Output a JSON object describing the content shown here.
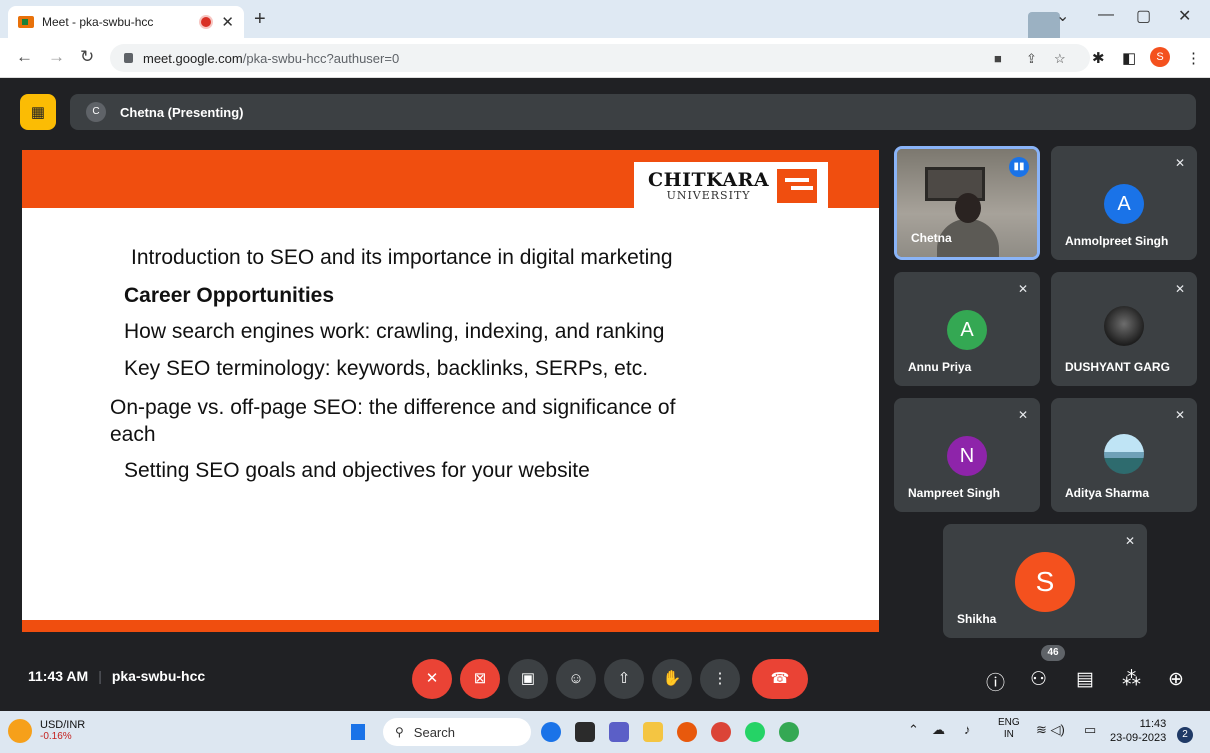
{
  "browser": {
    "tab_title": "Meet - pka-swbu-hcc",
    "url_host": "meet.google.com",
    "url_path": "/pka-swbu-hcc?authuser=0",
    "profile_initial": "S"
  },
  "meet": {
    "presenter_initial": "C",
    "presenter_label": "Chetna (Presenting)",
    "meeting_time": "11:43 AM",
    "meeting_code": "pka-swbu-hcc",
    "participant_count": "46"
  },
  "slide": {
    "logo_main": "CHITKARA",
    "logo_sub": "UNIVERSITY",
    "lines": [
      "Introduction to SEO and its importance in digital marketing",
      "Career Opportunities",
      "How search engines work: crawling, indexing, and ranking",
      "Key SEO terminology: keywords, backlinks, SERPs, etc.",
      "On-page vs. off-page SEO: the difference and significance of",
      "each",
      "Setting SEO goals and objectives for your website"
    ]
  },
  "participants": [
    {
      "name": "Chetna"
    },
    {
      "name": "Anmolpreet Singh",
      "initial": "A",
      "color": "#1a73e8"
    },
    {
      "name": "Annu Priya",
      "initial": "A",
      "color": "#34a853"
    },
    {
      "name": "DUSHYANT GARG"
    },
    {
      "name": "Nampreet Singh",
      "initial": "N",
      "color": "#8e24aa"
    },
    {
      "name": "Aditya Sharma"
    },
    {
      "name": "Shikha",
      "initial": "S",
      "color": "#f4511e"
    }
  ],
  "taskbar": {
    "ticker_name": "USD/INR",
    "ticker_change": "-0.16%",
    "search_placeholder": "Search",
    "lang_top": "ENG",
    "lang_bottom": "IN",
    "time": "11:43",
    "date": "23-09-2023",
    "notification_count": "2"
  }
}
